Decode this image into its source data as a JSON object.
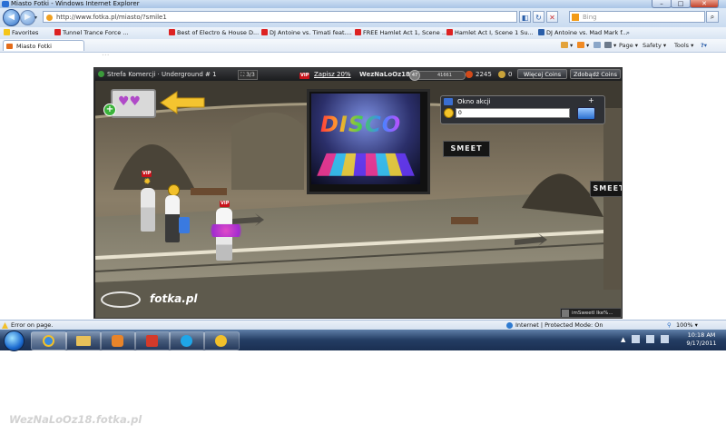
{
  "window": {
    "title": "Miasto Fotki - Windows Internet Explorer"
  },
  "address": {
    "url": "http://www.fotka.pl/miasto/?smile1",
    "search_placeholder": "Bing"
  },
  "favorites_bar": {
    "favorites_label": "Favorites",
    "items": [
      "Tunnel Trance Force ...",
      "Best of Electro & House D...",
      "DJ Antoine vs. Timati feat....",
      "FREE Hamlet Act 1, Scene ...",
      "Hamlet Act I, Scene 1 Su...",
      "DJ Antoine vs. Mad Mark f..."
    ]
  },
  "tab": {
    "title": "Miasto Fotki"
  },
  "command_bar": {
    "page": "Page ▾",
    "safety": "Safety ▾",
    "tools": "Tools ▾",
    "help": "?▾"
  },
  "page": {
    "faded_text": "..."
  },
  "game": {
    "location": "Strefa Komercji · Underground # 1",
    "people_count": "3/3",
    "vip_label": "VIP",
    "subscribe": "Zapisz 20%",
    "username": "WezNaLoOz18",
    "level": "47",
    "points": "41661",
    "coins": "2245",
    "other_count": "0",
    "more_coins": "Więcej Coins",
    "earn_coins": "Zdobądź Coins",
    "popup_title": "Okno akcji",
    "popup_input": "0",
    "disco_text": "DISCO",
    "sign_left": "SMEET",
    "sign_right": "SMEET",
    "logo": "fotka.pl",
    "bottom_label": "imSweetI Ike%..."
  },
  "status_bar": {
    "left": "Error on page.",
    "zone": "Internet | Protected Mode: On",
    "zoom": "100%"
  },
  "taskbar": {
    "time": "10:18 AM",
    "date": "9/17/2011"
  },
  "watermark": "WezNaLoOz18.fotka.pl",
  "colors": {
    "vip": "#c8131b",
    "arrow": "#f4c430",
    "ie_blue": "#2e6fc6"
  }
}
